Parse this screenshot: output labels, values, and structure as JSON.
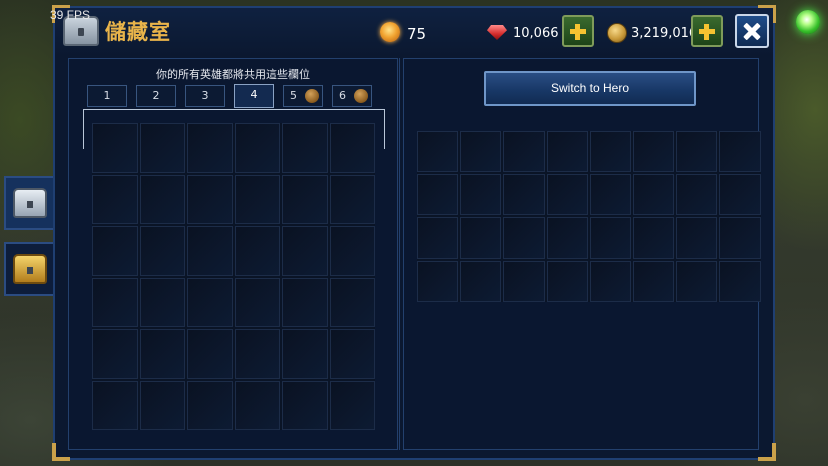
{
  "hud": {
    "fps": "39 FPS"
  },
  "header": {
    "title": "儲藏室",
    "orbs": "75",
    "gems": "10,066",
    "gold": "3,219,016"
  },
  "left": {
    "caption": "你的所有英雄都將共用這些欄位",
    "tabs": [
      {
        "label": "1",
        "locked": false
      },
      {
        "label": "2",
        "locked": false
      },
      {
        "label": "3",
        "locked": false
      },
      {
        "label": "4",
        "locked": false,
        "active": true
      },
      {
        "label": "5",
        "locked": true
      },
      {
        "label": "6",
        "locked": true
      }
    ],
    "grid": {
      "rows": 6,
      "cols": 6
    }
  },
  "right": {
    "switch_label": "Switch to Hero",
    "grid": {
      "rows": 4,
      "cols": 8
    }
  },
  "colors": {
    "panel": "#0b1830",
    "border": "#1f3f72",
    "title": "#e9b44a",
    "accent_gold": "#caa14a"
  }
}
